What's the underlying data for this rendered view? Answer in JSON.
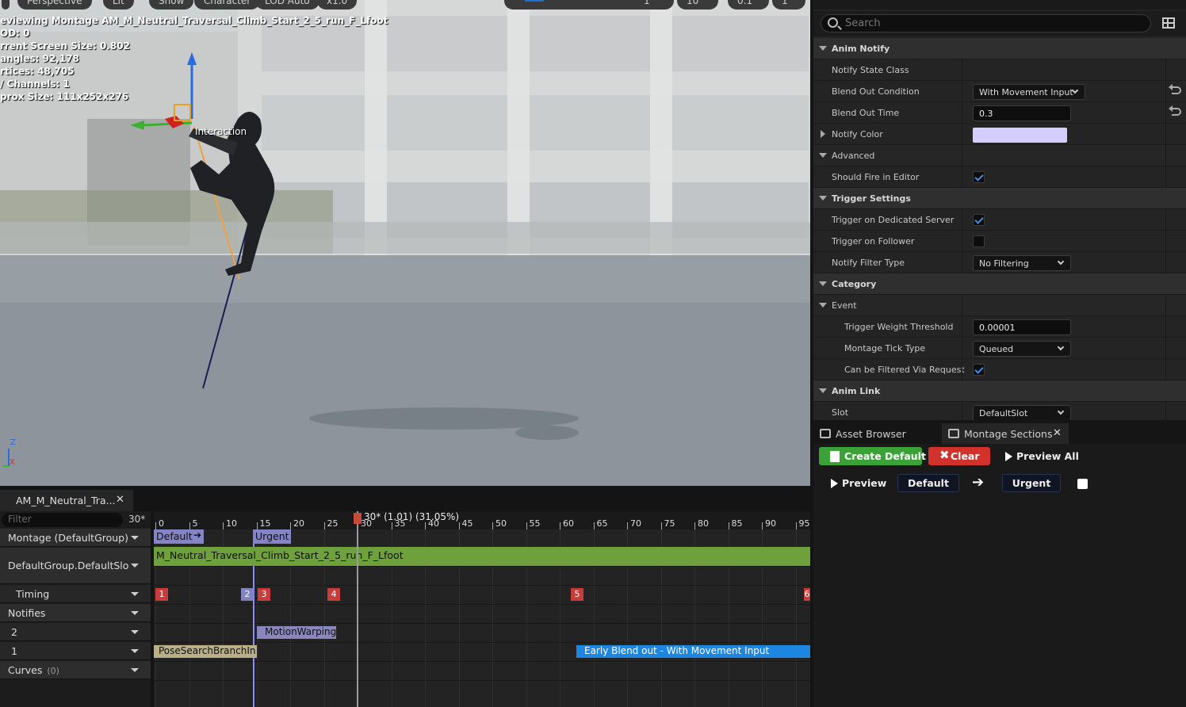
{
  "viewport": {
    "toolbar": [
      "Perspective",
      "Lit",
      "Show",
      "Character",
      "LOD Auto",
      "x1.0"
    ],
    "toolbar_right": [
      "1",
      "10",
      "0.1",
      "1"
    ],
    "stats": [
      "eviewing Montage AM_M_Neutral_Traversal_Climb_Start_2_5_run_F_Lfoot",
      "OD: 0",
      "rrent Screen Size: 0.802",
      "angles: 92,178",
      "rtices: 48,705",
      "/ Channels: 1",
      "prox Size: 111x252x276"
    ],
    "bone_label": "Interaction",
    "axis_z": "Z",
    "axis_x": "X"
  },
  "details": {
    "search_placeholder": "Search",
    "rows": [
      {
        "type": "cat",
        "label": "Anim Notify"
      },
      {
        "type": "prop",
        "label": "Notify State Class"
      },
      {
        "type": "combo",
        "label": "Blend Out Condition",
        "value": "With Movement Input",
        "reset": true
      },
      {
        "type": "num",
        "label": "Blend Out Time",
        "value": "0.3",
        "reset": true
      },
      {
        "type": "color",
        "label": "Notify Color",
        "color": "#d3ceff"
      },
      {
        "type": "sub",
        "label": "Advanced"
      },
      {
        "type": "check",
        "label": "Should Fire in Editor",
        "checked": true
      },
      {
        "type": "cat",
        "label": "Trigger Settings"
      },
      {
        "type": "check",
        "label": "Trigger on Dedicated Server",
        "checked": true
      },
      {
        "type": "check",
        "label": "Trigger on Follower",
        "checked": false
      },
      {
        "type": "combo",
        "label": "Notify Filter Type",
        "value": "No Filtering"
      },
      {
        "type": "cat",
        "label": "Category"
      },
      {
        "type": "sub",
        "label": "Event"
      },
      {
        "type": "num",
        "label": "Trigger Weight Threshold",
        "value": "0.00001",
        "indent": true
      },
      {
        "type": "combo",
        "label": "Montage Tick Type",
        "value": "Queued",
        "indent": true
      },
      {
        "type": "check",
        "label": "Can be Filtered Via Request",
        "checked": true,
        "indent": true
      },
      {
        "type": "cat",
        "label": "Anim Link"
      },
      {
        "type": "combo",
        "label": "Slot",
        "value": "DefaultSlot"
      }
    ]
  },
  "sections": {
    "tabs": [
      "Asset Browser",
      "Montage Sections"
    ],
    "create_default": "Create Default",
    "clear": "Clear",
    "preview_all": "Preview All",
    "preview": "Preview",
    "section_a": "Default",
    "section_b": "Urgent"
  },
  "timeline": {
    "tab_title": "AM_M_Neutral_Tra...",
    "filter_placeholder": "Filter",
    "fps": "30*",
    "playhead_label": "30* (1.01) (31.05%)",
    "ticks": [
      "0",
      "5",
      "10",
      "15",
      "20",
      "25",
      "30",
      "35",
      "40",
      "45",
      "50",
      "55",
      "60",
      "65",
      "70",
      "75",
      "80",
      "85",
      "90",
      "95"
    ],
    "tracks": [
      {
        "label": "Montage (DefaultGroup)"
      },
      {
        "label": "DefaultGroup.DefaultSlo"
      },
      {
        "label": "Timing"
      },
      {
        "label": "Notifies"
      },
      {
        "label": "2"
      },
      {
        "label": "1"
      },
      {
        "label": "Curves",
        "count": "(0)"
      }
    ],
    "section_chips": [
      "Default",
      "Urgent"
    ],
    "anim_sequence": "M_Neutral_Traversal_Climb_Start_2_5_run_F_Lfoot",
    "markers": [
      "1",
      "2",
      "3",
      "4",
      "5",
      "6"
    ],
    "notify_motion": "MotionWarping",
    "notify_pose": "PoseSearchBranchIn",
    "notify_blend": "Early Blend out - With Movement Input"
  }
}
